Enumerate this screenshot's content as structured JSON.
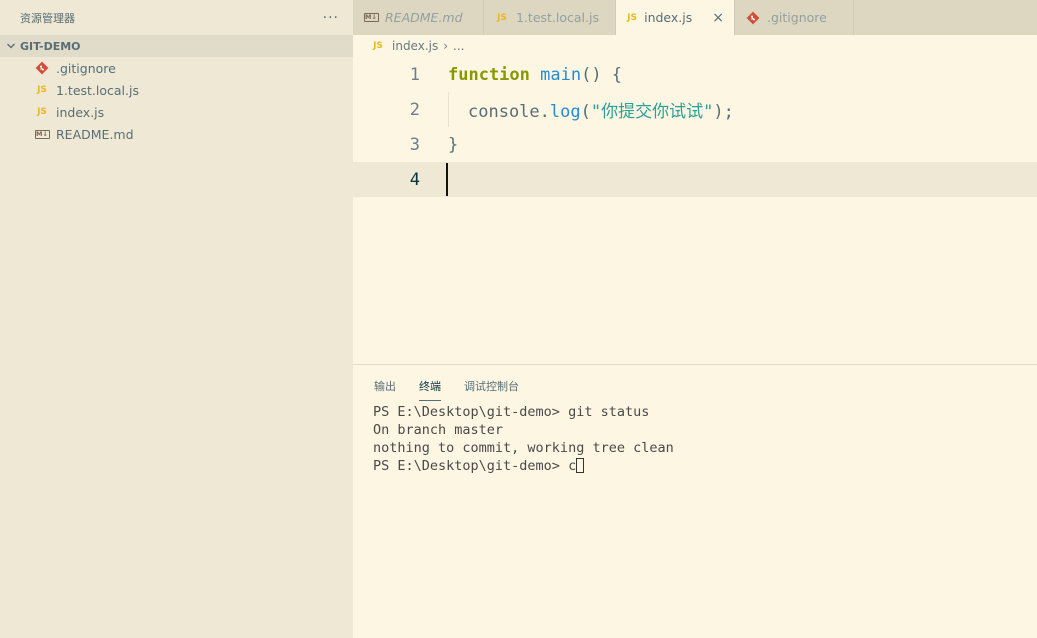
{
  "sidebar": {
    "title": "资源管理器",
    "more": "···",
    "section": "GIT-DEMO",
    "files": [
      {
        "name": ".gitignore",
        "icon": "git-icon"
      },
      {
        "name": "1.test.local.js",
        "icon": "js-icon",
        "badge": "JS"
      },
      {
        "name": "index.js",
        "icon": "js-icon",
        "badge": "JS"
      },
      {
        "name": "README.md",
        "icon": "markdown-icon",
        "badge": "M↓"
      }
    ]
  },
  "tabs": [
    {
      "label": "README.md",
      "icon": "markdown-icon",
      "badge": "M↓"
    },
    {
      "label": "1.test.local.js",
      "icon": "js-icon",
      "badge": "JS"
    },
    {
      "label": "index.js",
      "icon": "js-icon",
      "badge": "JS",
      "close": "×"
    },
    {
      "label": ".gitignore",
      "icon": "git-icon"
    }
  ],
  "breadcrumb": {
    "badge": "JS",
    "file": "index.js",
    "sep": "›",
    "rest": "..."
  },
  "editor": {
    "line_numbers": [
      "1",
      "2",
      "3",
      "4"
    ],
    "code": {
      "l1_kw": "function",
      "l1_fn": "main",
      "l1_rest": "() {",
      "l2_obj": "console.",
      "l2_fn": "log",
      "l2_open": "(",
      "l2_str": "\"你提交你试试\"",
      "l2_close": ");",
      "l3": "}"
    }
  },
  "panel": {
    "tabs": [
      "输出",
      "终端",
      "调试控制台"
    ],
    "terminal": [
      "PS E:\\Desktop\\git-demo> git status",
      "On branch master",
      "nothing to commit, working tree clean",
      "PS E:\\Desktop\\git-demo> c"
    ]
  },
  "colors": {
    "background": "#fdf6e3",
    "sidebar": "#eee8d5",
    "keyword": "#859900",
    "function": "#268bd2",
    "string": "#2aa198",
    "js_icon": "#e8b920",
    "git_icon": "#d14f3a"
  }
}
